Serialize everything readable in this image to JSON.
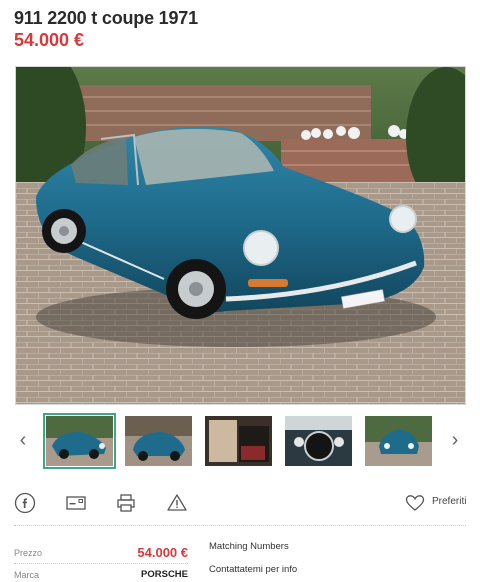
{
  "listing": {
    "title": "911 2200 t coupe 1971",
    "price": "54.000 €"
  },
  "gallery": {
    "prev_icon": "chevron-left-icon",
    "next_icon": "chevron-right-icon",
    "thumbnails": [
      {
        "name": "thumb-front-side",
        "active": true
      },
      {
        "name": "thumb-rear",
        "active": false
      },
      {
        "name": "thumb-interior",
        "active": false
      },
      {
        "name": "thumb-dashboard",
        "active": false
      },
      {
        "name": "thumb-front",
        "active": false
      }
    ]
  },
  "actions": {
    "icons": [
      "facebook-icon",
      "email-icon",
      "print-icon",
      "warning-icon"
    ],
    "favorites_label": "Preferiti"
  },
  "specs": [
    {
      "label": "Prezzo",
      "value": "54.000 €",
      "value_color": "#d9393b"
    },
    {
      "label": "Marca",
      "value": "PORSCHE",
      "value_color": "#222222"
    }
  ],
  "side_items": [
    "Matching Numbers",
    "Contattatemi per info"
  ],
  "colors": {
    "accent_red": "#d9393b",
    "thumb_active_border": "#41a58d",
    "car_blue": "#1f6b8c"
  }
}
